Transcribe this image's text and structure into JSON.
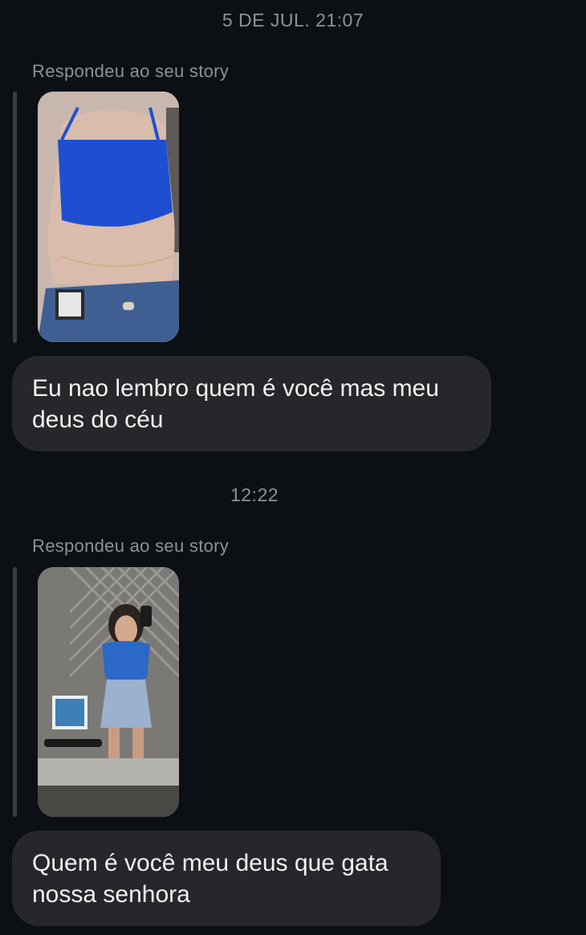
{
  "conversation": {
    "groups": [
      {
        "timestamp": "5 DE JUL. 21:07",
        "reply_label": "Respondeu ao seu story",
        "story_image": "story-thumbnail-blue-top",
        "message": "Eu nao lembro quem é você mas meu deus do céu"
      },
      {
        "timestamp": "12:22",
        "reply_label": "Respondeu ao seu story",
        "story_image": "story-thumbnail-mirror-selfie",
        "message": "Quem é você meu deus que gata nossa senhora"
      }
    ]
  },
  "colors": {
    "background": "#0c0f14",
    "bubble": "#25272b",
    "meta_text": "#8e9196",
    "reply_bar": "#3a3d42"
  }
}
